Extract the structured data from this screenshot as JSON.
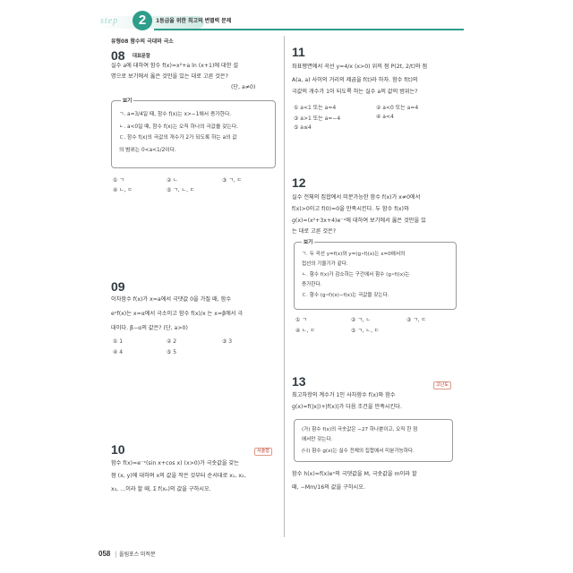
{
  "header": {
    "step_word": "step",
    "step_number": "2",
    "subtitle": "1등급을 위한 최고의 변별력 문제",
    "topic": "유형08 함수의 극대와 극소"
  },
  "problems": {
    "p08": {
      "number": "08",
      "tag": "대표문항",
      "lines": [
        "실수 a에 대하여 함수 f(x)=x²+a ln (x+1)에 대한 설",
        "명으로 보기에서 옳은 것만을 있는 대로 고른 것은?",
        "(단, a≠0)"
      ],
      "box_label": "보기",
      "box_lines": [
        "ㄱ. a=3/4일 때, 함수 f(x)는 x>−1에서 증가한다.",
        "ㄴ. a<0일 때, 함수 f(x)는 오직 하나의 극값을 갖는다.",
        "ㄷ. 함수 f(x)의 극값의 개수가 2가 되도록 하는 a의 값",
        "    의 범위는 0<a<1/2이다."
      ],
      "choices": [
        "① ㄱ",
        "② ㄴ",
        "③ ㄱ, ㄷ",
        "④ ㄴ, ㄷ",
        "⑤ ㄱ, ㄴ, ㄷ"
      ]
    },
    "p09": {
      "number": "09",
      "lines": [
        "이차함수 f(x)가 x=a에서 극댓값 0을 가질 때, 함수",
        "eˣf(x)는 x=α에서 극소이고 함수 f(x)/x 는 x=β에서 극",
        "대이다. β−α의 값은? (단, a>0)"
      ],
      "choices": [
        "① 1",
        "② 2",
        "③ 3",
        "④ 4",
        "⑤ 5"
      ]
    },
    "p10": {
      "number": "10",
      "tag": "서술형",
      "lines": [
        "함수 f(x)=e⁻ˣ(sin x+cos x) (x>0)가 극솟값을 갖는",
        "점 (x, y)에 대하여 x의 값을 작은 것부터 순서대로 x₁, x₂,",
        "x₃, …이라 할 때, Σ f(xₙ)의 값을 구하시오."
      ]
    },
    "p11": {
      "number": "11",
      "lines": [
        "좌표평면에서 곡선 y=4/x (x>0) 위의 점 P(2t, 2/t)와 점",
        "A(a, a) 사이의 거리의 제곱을 f(t)라 하자. 함수 f(t)의",
        "극값의 개수가 1이 되도록 하는 실수 a의 값의 범위는?"
      ],
      "choices": [
        "① a<1 또는 a=4",
        "② a<0 또는 a=4",
        "③ a>1 또는 a=−4",
        "④ a<4",
        "⑤ a≤4"
      ]
    },
    "p12": {
      "number": "12",
      "lines": [
        "실수 전체의 집합에서 미분가능한 함수 f(x)가 x≠0에서",
        "f(x)>0이고 f(0)=0을 만족시킨다. 두 함수 f(x)와",
        "g(x)=(x²+3x+4)e⁻ˣ에 대하여 보기에서 옳은 것만을 있",
        "는 대로 고른 것은?"
      ],
      "box_label": "보기",
      "box_lines": [
        "ㄱ. 두 곡선 y=f(x)와 y=(g∘f)(x)는 x=0에서의",
        "    접선의 기울기가 같다.",
        "ㄴ. 함수 f(x)가 감소하는 구간에서 함수 (g∘f)(x)는",
        "    증가한다.",
        "ㄷ. 함수 (g∘f)(x)−f(x)는 극값을 갖는다."
      ],
      "choices": [
        "① ㄱ",
        "② ㄱ, ㄴ",
        "③ ㄱ, ㄷ",
        "④ ㄴ, ㄷ",
        "⑤ ㄱ, ㄴ, ㄷ"
      ]
    },
    "p13": {
      "number": "13",
      "tag": "고난도",
      "lines": [
        "최고차항의 계수가 1인 사차함수 f(x)와 함수",
        "g(x)=f(|x|)+|f(x)|가 다음 조건을 만족시킨다."
      ],
      "box_lines": [
        "(가) 함수 f(x)의 극솟값은 −27 하나뿐이고, 오직 한 점",
        "     에서만 갖는다.",
        "(나) 함수 g(x)는 실수 전체의 집합에서 미분가능하다."
      ],
      "after_lines": [
        "함수 h(x)=f(x)eˣ의 극댓값을 M, 극솟값을 m이라 할",
        "때, −Mm/16의 값을 구하시오."
      ]
    }
  },
  "footer": {
    "page": "058",
    "book": "올림포스 미적분"
  },
  "colors": {
    "accent": "#2e9d8a",
    "accent_light": "#9fd6c9"
  }
}
